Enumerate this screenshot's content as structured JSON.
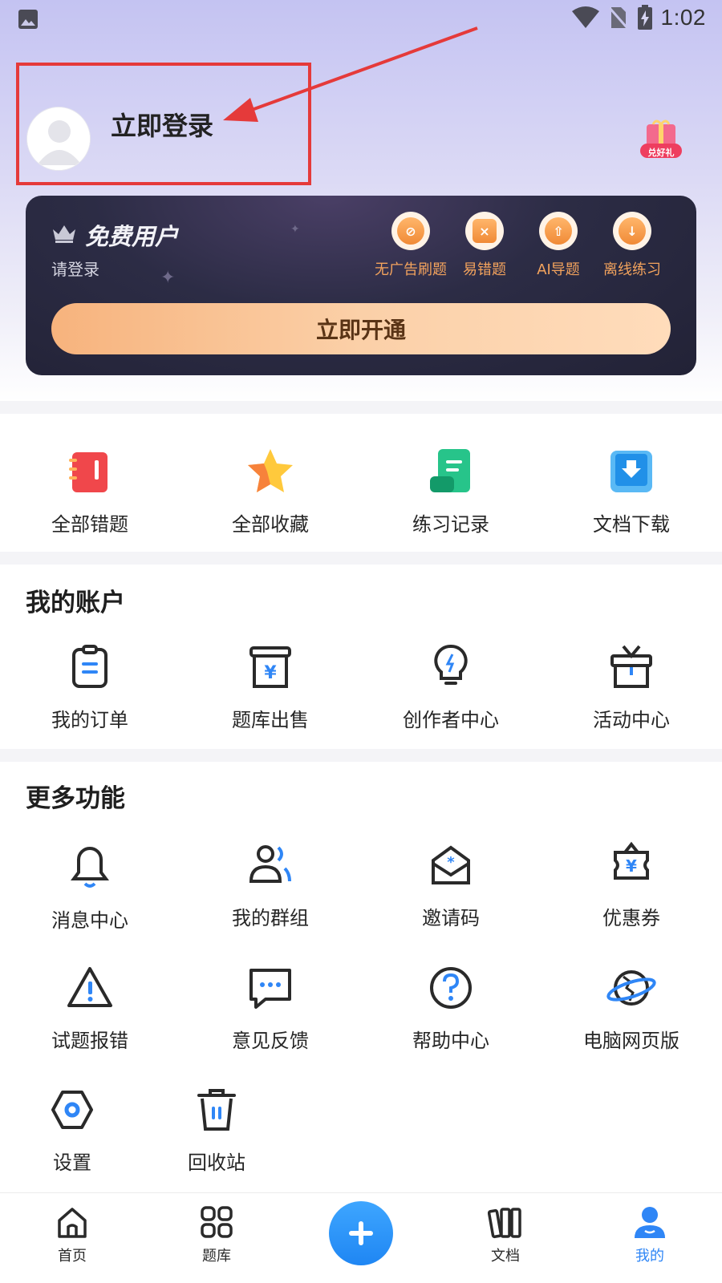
{
  "status_bar": {
    "time": "1:02",
    "icons": [
      "gallery-icon",
      "wifi-icon",
      "no-sim-icon",
      "battery-charging-icon"
    ]
  },
  "profile": {
    "login_label": "立即登录",
    "gift_badge": "兑好礼"
  },
  "vip_card": {
    "title": "免费用户",
    "subtitle": "请登录",
    "perks": [
      {
        "label": "无广告刷题",
        "icon": "no-ads-icon"
      },
      {
        "label": "易错题",
        "icon": "error-question-icon"
      },
      {
        "label": "AI导题",
        "icon": "ai-import-icon"
      },
      {
        "label": "离线练习",
        "icon": "offline-download-icon"
      }
    ],
    "open_button": "立即开通",
    "accent_color": "#f3a35d"
  },
  "quick_actions": [
    {
      "label": "全部错题",
      "icon": "notebook-icon"
    },
    {
      "label": "全部收藏",
      "icon": "star-icon"
    },
    {
      "label": "练习记录",
      "icon": "record-icon"
    },
    {
      "label": "文档下载",
      "icon": "document-download-icon"
    }
  ],
  "account": {
    "title": "我的账户",
    "items": [
      {
        "label": "我的订单",
        "icon": "order-icon"
      },
      {
        "label": "题库出售",
        "icon": "sale-icon"
      },
      {
        "label": "创作者中心",
        "icon": "lightbulb-icon"
      },
      {
        "label": "活动中心",
        "icon": "gift-box-icon"
      }
    ]
  },
  "more": {
    "title": "更多功能",
    "items": [
      {
        "label": "消息中心",
        "icon": "bell-icon"
      },
      {
        "label": "我的群组",
        "icon": "group-icon"
      },
      {
        "label": "邀请码",
        "icon": "invite-mail-icon"
      },
      {
        "label": "优惠券",
        "icon": "coupon-icon"
      },
      {
        "label": "试题报错",
        "icon": "warning-icon"
      },
      {
        "label": "意见反馈",
        "icon": "feedback-icon"
      },
      {
        "label": "帮助中心",
        "icon": "help-icon"
      },
      {
        "label": "电脑网页版",
        "icon": "planet-icon"
      },
      {
        "label": "设置",
        "icon": "settings-icon"
      },
      {
        "label": "回收站",
        "icon": "trash-icon"
      }
    ]
  },
  "tab_bar": {
    "tabs": [
      {
        "label": "首页",
        "icon": "home-icon"
      },
      {
        "label": "题库",
        "icon": "grid-icon"
      },
      {
        "label": "",
        "icon": "plus-icon"
      },
      {
        "label": "文档",
        "icon": "books-icon"
      },
      {
        "label": "我的",
        "icon": "user-icon"
      }
    ],
    "active": "我的",
    "active_color": "#2f86f6"
  }
}
